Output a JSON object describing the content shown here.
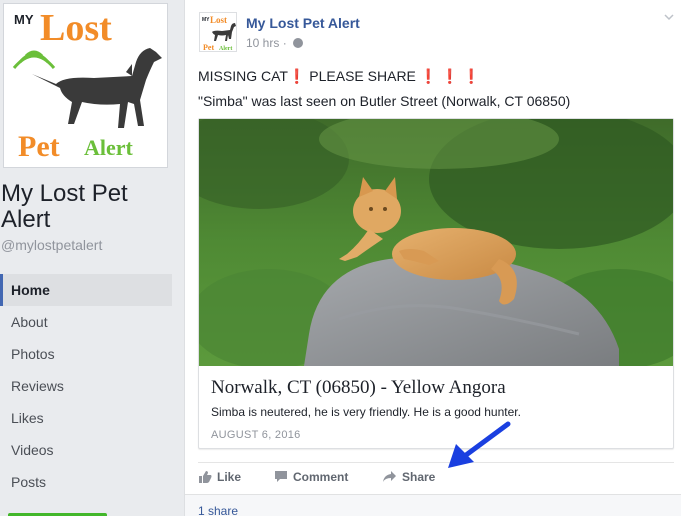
{
  "sidebar": {
    "page_name": "My Lost Pet Alert",
    "handle": "@mylostpetalert",
    "logo": {
      "text_top": "MY",
      "text_lost": "Lost",
      "text_pet": "Pet",
      "text_alert": "Alert"
    },
    "nav": [
      {
        "label": "Home",
        "active": true
      },
      {
        "label": "About"
      },
      {
        "label": "Photos"
      },
      {
        "label": "Reviews"
      },
      {
        "label": "Likes"
      },
      {
        "label": "Videos"
      },
      {
        "label": "Posts"
      }
    ]
  },
  "post": {
    "author": "My Lost Pet Alert",
    "time": "10 hrs",
    "separator": "·",
    "line1_prefix": "MISSING CAT",
    "line1_mid": " PLEASE SHARE ",
    "excl": "❗",
    "line2": "\"Simba\" was last seen on Butler Street (Norwalk, CT 06850)",
    "preview": {
      "title": "Norwalk, CT (06850) - Yellow Angora",
      "description": "Simba is neutered, he is very friendly. He is a good hunter.",
      "date": "AUGUST 6, 2016"
    },
    "actions": {
      "like": "Like",
      "comment": "Comment",
      "share": "Share"
    },
    "shares": "1 share"
  },
  "colors": {
    "accent": "#4267b2",
    "link": "#365899",
    "arrow": "#1a3fe0",
    "logo_orange": "#f28c28",
    "logo_green": "#6bbf3a"
  }
}
